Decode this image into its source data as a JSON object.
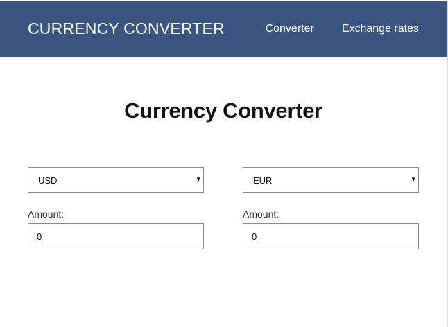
{
  "header": {
    "brand": "CURRENCY CONVERTER",
    "nav": [
      {
        "label": "Converter",
        "active": true
      },
      {
        "label": "Exchange rates",
        "active": false
      }
    ],
    "background_color": "#3b5582"
  },
  "main": {
    "title": "Currency Converter",
    "from": {
      "currency": "USD",
      "amount_label": "Amount:",
      "amount_value": "0"
    },
    "to": {
      "currency": "EUR",
      "amount_label": "Amount:",
      "amount_value": "0"
    }
  },
  "icons": {
    "dropdown_arrow": "chevron-down-icon"
  }
}
